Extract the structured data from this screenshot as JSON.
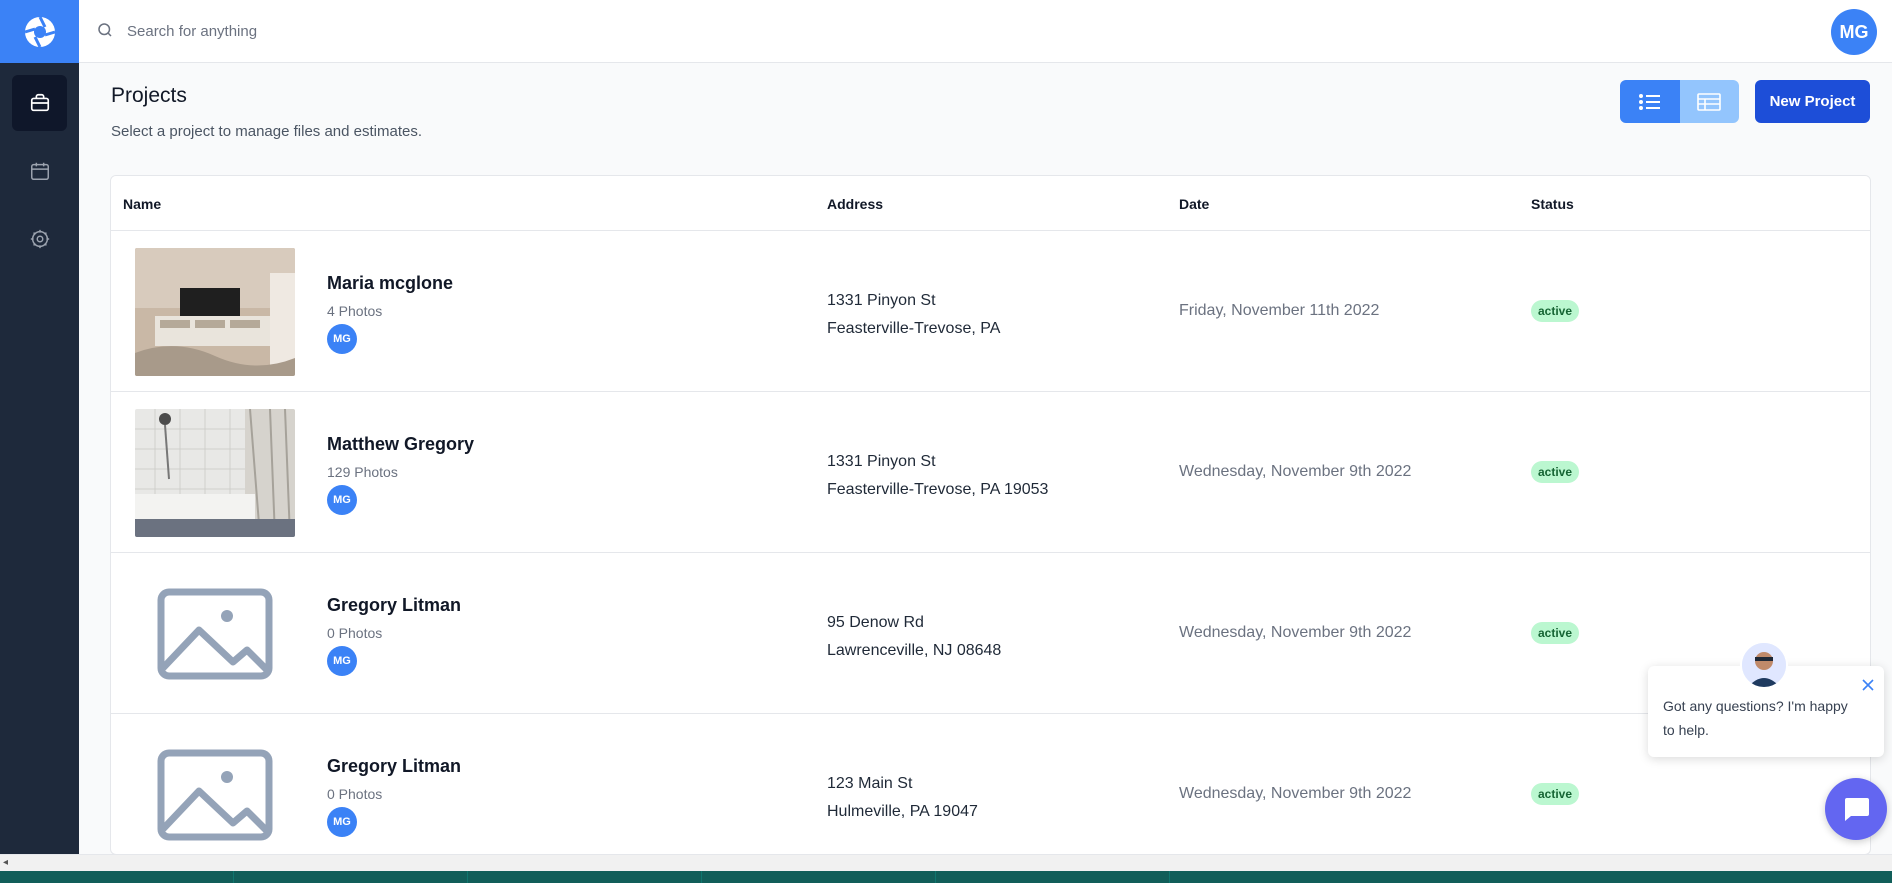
{
  "search": {
    "placeholder": "Search for anything"
  },
  "user": {
    "initials": "MG"
  },
  "header": {
    "title": "Projects",
    "subtitle": "Select a project to manage files and estimates.",
    "new_project_label": "New Project"
  },
  "table": {
    "columns": [
      "Name",
      "Address",
      "Date",
      "Status"
    ],
    "rows": [
      {
        "name": "Maria mcglone",
        "photos": "4 Photos",
        "avatar": "MG",
        "address_line1": "1331 Pinyon St",
        "address_line2": "Feasterville-Trevose, PA",
        "date": "Friday, November 11th 2022",
        "status": "active"
      },
      {
        "name": "Matthew Gregory",
        "photos": "129 Photos",
        "avatar": "MG",
        "address_line1": "1331 Pinyon St",
        "address_line2": "Feasterville-Trevose, PA 19053",
        "date": "Wednesday, November 9th 2022",
        "status": "active"
      },
      {
        "name": "Gregory Litman",
        "photos": "0 Photos",
        "avatar": "MG",
        "address_line1": "95 Denow Rd",
        "address_line2": "Lawrenceville, NJ 08648",
        "date": "Wednesday, November 9th 2022",
        "status": "active"
      },
      {
        "name": "Gregory Litman",
        "photos": "0 Photos",
        "avatar": "MG",
        "address_line1": "123 Main St",
        "address_line2": "Hulmeville, PA 19047",
        "date": "Wednesday, November 9th 2022",
        "status": "active"
      }
    ]
  },
  "chat": {
    "message": "Got any questions? I'm happy to help."
  },
  "icons": {
    "logo": "aperture-logo-icon",
    "nav": [
      "briefcase-icon",
      "calendar-icon",
      "gear-icon"
    ],
    "search": "search-icon",
    "view_list": "list-view-icon",
    "view_table": "table-view-icon",
    "placeholder": "image-placeholder-icon",
    "chat_close": "close-icon",
    "chat_launcher": "chat-bubble-icon"
  },
  "colors": {
    "sidebar": "#1e293b",
    "accent": "#3b82f6",
    "primary_button": "#1d4ed8",
    "badge_bg": "#bbf7d0",
    "badge_text": "#166534",
    "chat": "#6366f1"
  }
}
